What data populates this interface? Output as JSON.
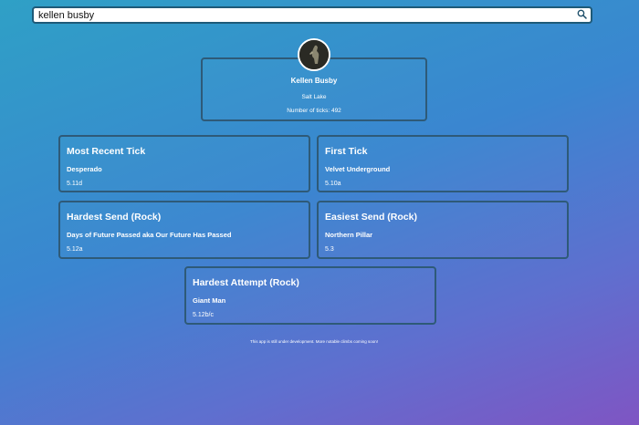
{
  "search": {
    "value": "kellen busby",
    "icon": "search-icon"
  },
  "profile": {
    "name": "Kellen Busby",
    "location": "Salt Lake",
    "ticks_text": "Number of ticks: 492"
  },
  "stats": [
    {
      "title": "Most Recent Tick",
      "route": "Desperado",
      "grade": "5.11d"
    },
    {
      "title": "First Tick",
      "route": "Velvet Underground",
      "grade": "5.10a"
    },
    {
      "title": "Hardest Send (Rock)",
      "route": "Days of Future Passed aka Our Future Has Passed",
      "grade": "5.12a"
    },
    {
      "title": "Easiest Send (Rock)",
      "route": "Northern Pillar",
      "grade": "5.3"
    },
    {
      "title": "Hardest Attempt (Rock)",
      "route": "Giant Man",
      "grade": "5.12b/c"
    }
  ],
  "footer": {
    "note": "This app is still under development. More notable climbs coming soon!"
  }
}
